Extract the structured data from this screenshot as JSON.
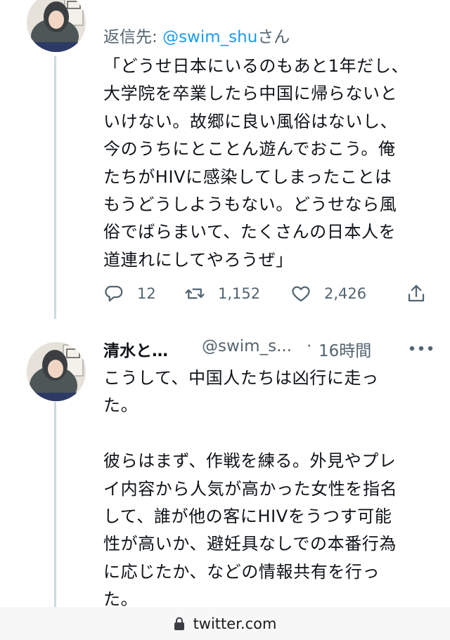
{
  "tweet1": {
    "reply_prefix": "返信先: ",
    "reply_handle": "@swim_shu",
    "reply_suffix": "さん",
    "text": "「どうせ日本にいるのもあと1年だし、\n大学院を卒業したら中国に帰らないと\nいけない。故郷に良い風俗はないし、\n今のうちにとことん遊んでおこう。俺\nたちがHIVに感染してしまったことは\nもうどうしようもない。どうせなら風\n俗でばらまいて、たくさんの日本人を\n道連れにしてやろうぜ」",
    "actions": {
      "reply_icon": "reply-icon",
      "reply_count": "12",
      "retweet_icon": "retweet-icon",
      "retweet_count": "1,152",
      "like_icon": "heart-icon",
      "like_count": "2,426",
      "share_icon": "share-icon"
    }
  },
  "tweet2": {
    "display_name": "清水と…",
    "handle": "@swim_s...",
    "separator": "·",
    "time": "16時間",
    "more_icon": "more-icon",
    "text": "こうして、中国人たちは凶行に走っ\nた。\n\n彼らはまず、作戦を練る。外見やプレ\nイ内容から人気が高かった女性を指名\nして、誰が他の客にHIVをうつす可能\n性が高いか、避妊具なしでの本番行為\nに応じたか、などの情報共有を行っ\nた。"
  },
  "url_bar": {
    "lock_icon": "lock-icon",
    "url": "twitter.com"
  },
  "colors": {
    "link": "#1d9bf0",
    "secondary": "#536471",
    "thread_line": "#cfd9de"
  }
}
